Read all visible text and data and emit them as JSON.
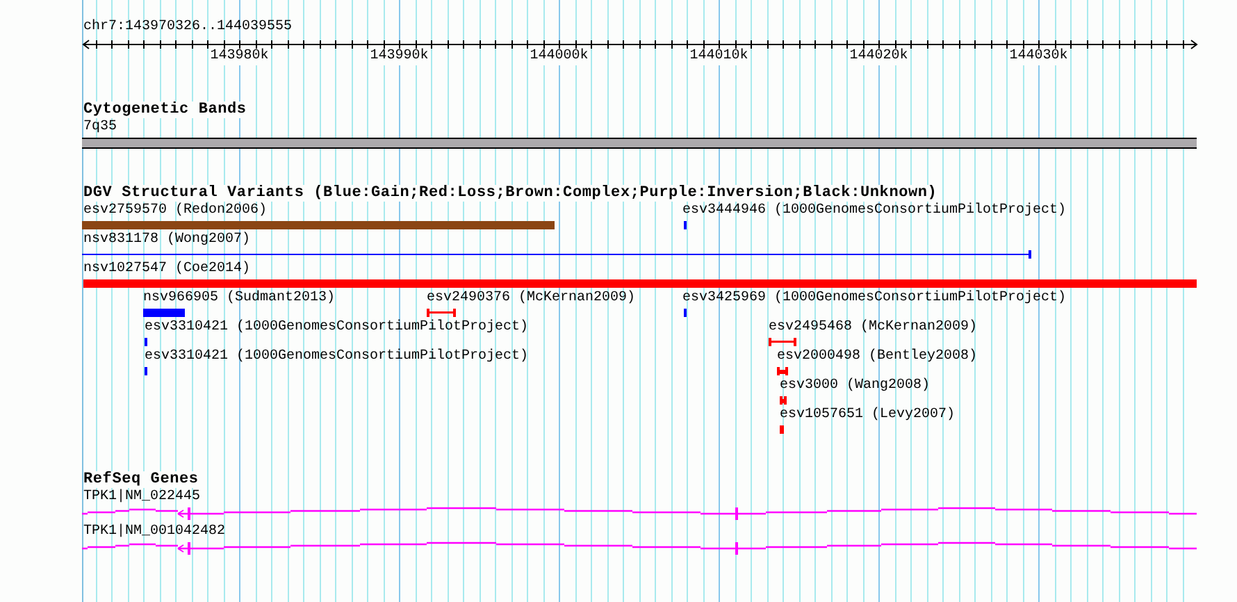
{
  "ruler": {
    "range": "chr7:143970326..144039555",
    "ticks": [
      "143980k",
      "143990k",
      "144000k",
      "144010k",
      "144020k",
      "144030k"
    ]
  },
  "tracks": [
    {
      "kind": "bands",
      "title": "Cytogenetic Bands",
      "features": [
        {
          "kind": "band",
          "label": "7q35"
        }
      ]
    },
    {
      "kind": "variants",
      "title": "DGV Structural Variants (Blue:Gain;Red:Loss;Brown:Complex;Purple:Inversion;Black:Unknown)",
      "features": [
        {
          "kind": "bar",
          "label": "esv2759570 (Redon2006)",
          "color": "#8b4513"
        },
        {
          "kind": "bar",
          "label": "esv3444946 (1000GenomesConsortiumPilotProject)",
          "color": "#0000ff"
        },
        {
          "kind": "line",
          "label": "nsv831178 (Wong2007)",
          "color": "#0000ff"
        },
        {
          "kind": "bar",
          "label": "nsv1027547 (Coe2014)",
          "color": "#ff0000"
        },
        {
          "kind": "bar",
          "label": "nsv966905 (Sudmant2013)",
          "color": "#0000ff"
        },
        {
          "kind": "range",
          "label": "esv2490376 (McKernan2009)",
          "color": "#ff0000"
        },
        {
          "kind": "bar",
          "label": "esv3425969 (1000GenomesConsortiumPilotProject)",
          "color": "#0000ff"
        },
        {
          "kind": "bar",
          "label": "esv3310421 (1000GenomesConsortiumPilotProject)",
          "color": "#0000ff"
        },
        {
          "kind": "range",
          "label": "esv2495468 (McKernan2009)",
          "color": "#ff0000"
        },
        {
          "kind": "bar",
          "label": "esv3310421 (1000GenomesConsortiumPilotProject)",
          "color": "#0000ff"
        },
        {
          "kind": "range",
          "label": "esv2000498 (Bentley2008)",
          "color": "#ff0000"
        },
        {
          "kind": "range",
          "label": "esv3000 (Wang2008)",
          "color": "#ff0000"
        },
        {
          "kind": "bar",
          "label": "esv1057651 (Levy2007)",
          "color": "#ff0000"
        }
      ]
    },
    {
      "kind": "genes",
      "title": "RefSeq Genes",
      "features": [
        {
          "kind": "gene",
          "label": "TPK1|NM_022445"
        },
        {
          "kind": "gene",
          "label": "TPK1|NM_001042482"
        }
      ]
    }
  ]
}
